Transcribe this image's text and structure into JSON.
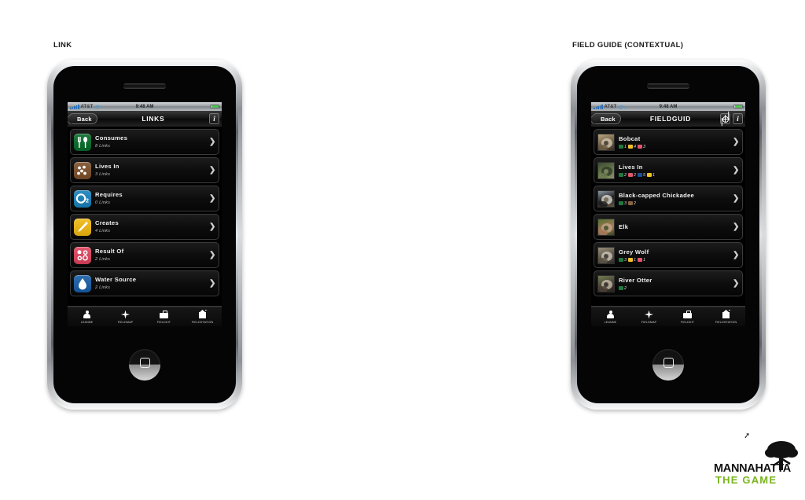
{
  "panels": {
    "left_caption": "LINK",
    "right_caption": "FIELD GUIDE (CONTEXTUAL)"
  },
  "status_bar": {
    "carrier": "AT&T",
    "time": "9:48 AM",
    "signal_icon": "signal-bars-icon",
    "wifi_icon": "wifi-icon",
    "battery_icon": "battery-icon"
  },
  "left_phone": {
    "nav": {
      "back_label": "Back",
      "title": "LINKS",
      "info_label": "i"
    },
    "rows": [
      {
        "title": "Consumes",
        "subtitle": "8 Links",
        "icon": "fork-and-spoon-icon",
        "color": "#1f7a3f"
      },
      {
        "title": "Lives In",
        "subtitle": "3 Links",
        "icon": "burrow-dots-icon",
        "color": "#8a6240"
      },
      {
        "title": "Requires",
        "subtitle": "0 Links",
        "icon": "oxygen-o2-icon",
        "color": "#2f8fc4"
      },
      {
        "title": "Creates",
        "subtitle": "4 Links",
        "icon": "paintbrush-icon",
        "color": "#f2c029"
      },
      {
        "title": "Result Of",
        "subtitle": "2 Links",
        "icon": "molecule-dots-icon",
        "color": "#e2566e"
      },
      {
        "title": "Water Source",
        "subtitle": "2 Links",
        "icon": "water-drop-icon",
        "color": "#2f6fb0"
      }
    ]
  },
  "right_phone": {
    "nav": {
      "back_label": "Back",
      "title": "FIELDGUID",
      "locate_label": "",
      "info_label": "i"
    },
    "rows": [
      {
        "title": "Bobcat",
        "thumb": "bobcat-photo",
        "badges": [
          {
            "color": "#1f7a3f",
            "count": "1"
          },
          {
            "color": "#f2c029",
            "count": "4"
          },
          {
            "color": "#e2566e",
            "count": "3"
          }
        ]
      },
      {
        "title": "Lives In",
        "thumb": "habitat-photo",
        "badges": [
          {
            "color": "#1f7a3f",
            "count": "2"
          },
          {
            "color": "#e2566e",
            "count": "2"
          },
          {
            "color": "#1b4f9c",
            "count": "5"
          },
          {
            "color": "#f2c029",
            "count": "1"
          }
        ]
      },
      {
        "title": "Black-capped Chickadee",
        "thumb": "chickadee-photo",
        "badges": [
          {
            "color": "#1f7a3f",
            "count": "3"
          },
          {
            "color": "#8a6240",
            "count": "2"
          }
        ]
      },
      {
        "title": "Elk",
        "thumb": "elk-photo",
        "badges": []
      },
      {
        "title": "Grey Wolf",
        "thumb": "grey-wolf-photo",
        "badges": [
          {
            "color": "#1f7a3f",
            "count": "3"
          },
          {
            "color": "#f2c029",
            "count": "1"
          },
          {
            "color": "#e2566e",
            "count": "1"
          }
        ]
      },
      {
        "title": "River Otter",
        "thumb": "river-otter-photo",
        "badges": [
          {
            "color": "#1f7a3f",
            "count": "2"
          }
        ]
      }
    ]
  },
  "tabbar": {
    "tabs": [
      {
        "label": "LEANNE",
        "icon": "person-icon"
      },
      {
        "label": "FIELDMAP",
        "icon": "compass-star-icon"
      },
      {
        "label": "FIELDKIT",
        "icon": "briefcase-icon"
      },
      {
        "label": "FIELDSTATION",
        "icon": "field-station-icon"
      }
    ]
  },
  "logo": {
    "name": "MANNAHATTA",
    "tagline": "THE GAME",
    "accent_color": "#7ab41d",
    "bird_icon": "bird-icon",
    "tree_icon": "tree-icon"
  },
  "chevron": "❯"
}
